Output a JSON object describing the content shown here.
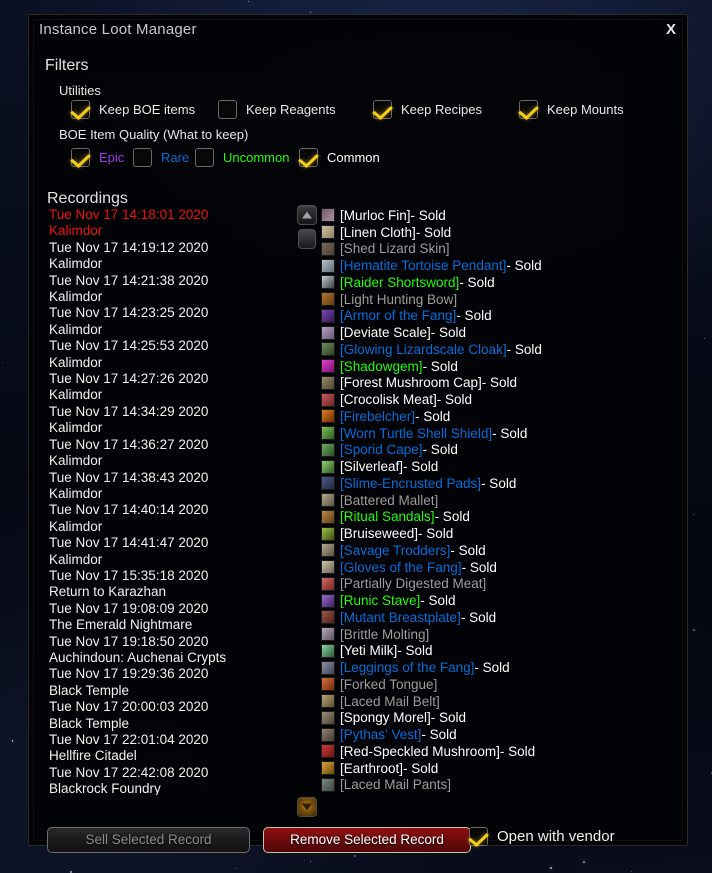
{
  "window": {
    "title": "Instance Loot Manager",
    "close_label": "X"
  },
  "filters": {
    "heading": "Filters",
    "utilities": {
      "heading": "Utilities",
      "options": [
        {
          "label": "Keep BOE items",
          "checked": true
        },
        {
          "label": "Keep Reagents",
          "checked": false
        },
        {
          "label": "Keep Recipes",
          "checked": true
        },
        {
          "label": "Keep Mounts",
          "checked": true
        }
      ]
    },
    "quality": {
      "heading": "BOE Item Quality (What to keep)",
      "options": [
        {
          "label": "Epic",
          "checked": true,
          "color": "#a335ee"
        },
        {
          "label": "Rare",
          "checked": false,
          "color": "#0070dd"
        },
        {
          "label": "Uncommon",
          "checked": false,
          "color": "#1eff00"
        },
        {
          "label": "Common",
          "checked": true,
          "color": "#ffffff"
        }
      ]
    }
  },
  "recordings": {
    "heading": "Recordings",
    "selected_index": 0,
    "items": [
      {
        "date": "Tue Nov 17 14:18:01 2020",
        "zone": "Kalimdor"
      },
      {
        "date": "Tue Nov 17 14:19:12 2020",
        "zone": "Kalimdor"
      },
      {
        "date": "Tue Nov 17 14:21:38 2020",
        "zone": "Kalimdor"
      },
      {
        "date": "Tue Nov 17 14:23:25 2020",
        "zone": "Kalimdor"
      },
      {
        "date": "Tue Nov 17 14:25:53 2020",
        "zone": "Kalimdor"
      },
      {
        "date": "Tue Nov 17 14:27:26 2020",
        "zone": "Kalimdor"
      },
      {
        "date": "Tue Nov 17 14:34:29 2020",
        "zone": "Kalimdor"
      },
      {
        "date": "Tue Nov 17 14:36:27 2020",
        "zone": "Kalimdor"
      },
      {
        "date": "Tue Nov 17 14:38:43 2020",
        "zone": "Kalimdor"
      },
      {
        "date": "Tue Nov 17 14:40:14 2020",
        "zone": "Kalimdor"
      },
      {
        "date": "Tue Nov 17 14:41:47 2020",
        "zone": "Kalimdor"
      },
      {
        "date": "Tue Nov 17 15:35:18 2020",
        "zone": "Return to Karazhan"
      },
      {
        "date": "Tue Nov 17 19:08:09 2020",
        "zone": "The Emerald Nightmare"
      },
      {
        "date": "Tue Nov 17 19:18:50 2020",
        "zone": "Auchindoun: Auchenai Crypts"
      },
      {
        "date": "Tue Nov 17 19:29:36 2020",
        "zone": "Black Temple"
      },
      {
        "date": "Tue Nov 17 20:00:03 2020",
        "zone": "Black Temple"
      },
      {
        "date": "Tue Nov 17 22:01:04 2020",
        "zone": "Hellfire Citadel"
      },
      {
        "date": "Tue Nov 17 22:42:08 2020",
        "zone": "Blackrock Foundry"
      }
    ]
  },
  "loot": {
    "status_sold": " - Sold",
    "quality_colors": {
      "poor": "#9d9d9d",
      "common": "#ffffff",
      "uncommon": "#1eff00",
      "rare": "#0070dd",
      "epic": "#a335ee"
    },
    "items": [
      {
        "name": "[Murloc Fin]",
        "quality": "common",
        "sold": true,
        "icon": "#6f5a68,#ad93a8"
      },
      {
        "name": "[Linen Cloth]",
        "quality": "common",
        "sold": true,
        "icon": "#cbbfa2,#8d8165"
      },
      {
        "name": "[Shed Lizard Skin]",
        "quality": "poor",
        "sold": false,
        "icon": "#7a6a5a,#4b4038"
      },
      {
        "name": "[Hematite Tortoise Pendant]",
        "quality": "rare",
        "sold": true,
        "icon": "#b9c3cc,#5f6a74"
      },
      {
        "name": "[Raider Shortsword]",
        "quality": "uncommon",
        "sold": true,
        "icon": "#c8cdd4,#3a3f46"
      },
      {
        "name": "[Light Hunting Bow]",
        "quality": "poor",
        "sold": false,
        "icon": "#b5762d,#5e3a12"
      },
      {
        "name": "[Armor of the Fang]",
        "quality": "rare",
        "sold": true,
        "icon": "#7b4bb5,#30184f"
      },
      {
        "name": "[Deviate Scale]",
        "quality": "common",
        "sold": true,
        "icon": "#b59ec0,#6b5a78"
      },
      {
        "name": "[Glowing Lizardscale Cloak]",
        "quality": "rare",
        "sold": true,
        "icon": "#6f8f5a,#2f4024"
      },
      {
        "name": "[Shadowgem]",
        "quality": "uncommon",
        "sold": true,
        "icon": "#e03fd0,#7a1370"
      },
      {
        "name": "[Forest Mushroom Cap]",
        "quality": "common",
        "sold": true,
        "icon": "#9a8a6d,#4f452f"
      },
      {
        "name": "[Crocolisk Meat]",
        "quality": "common",
        "sold": true,
        "icon": "#c85d5d,#6e2424"
      },
      {
        "name": "[Firebelcher]",
        "quality": "rare",
        "sold": true,
        "icon": "#e07a22,#6b2f06"
      },
      {
        "name": "[Worn Turtle Shell Shield]",
        "quality": "rare",
        "sold": true,
        "icon": "#7cc05a,#2f5a20"
      },
      {
        "name": "[Sporid Cape]",
        "quality": "rare",
        "sold": true,
        "icon": "#6fae64,#2b4a26"
      },
      {
        "name": "[Silverleaf]",
        "quality": "common",
        "sold": true,
        "icon": "#8fd06a,#2f5a24"
      },
      {
        "name": "[Slime-Encrusted Pads]",
        "quality": "rare",
        "sold": true,
        "icon": "#4d5a8a,#20263f"
      },
      {
        "name": "[Battered Mallet]",
        "quality": "poor",
        "sold": false,
        "icon": "#b5a78c,#5d5241"
      },
      {
        "name": "[Ritual Sandals]",
        "quality": "uncommon",
        "sold": true,
        "icon": "#c08a4a,#5c3c18"
      },
      {
        "name": "[Bruiseweed]",
        "quality": "common",
        "sold": true,
        "icon": "#9fbf4a,#3f5012"
      },
      {
        "name": "[Savage Trodders]",
        "quality": "rare",
        "sold": true,
        "icon": "#b3a88f,#58503f"
      },
      {
        "name": "[Gloves of the Fang]",
        "quality": "rare",
        "sold": true,
        "icon": "#cfc6ae,#6a6050"
      },
      {
        "name": "[Partially Digested Meat]",
        "quality": "poor",
        "sold": false,
        "icon": "#d06a6a,#742424"
      },
      {
        "name": "[Runic Stave]",
        "quality": "uncommon",
        "sold": true,
        "icon": "#9b6ad0,#3c2060"
      },
      {
        "name": "[Mutant Breastplate]",
        "quality": "rare",
        "sold": true,
        "icon": "#a2564a,#4a2018"
      },
      {
        "name": "[Brittle Molting]",
        "quality": "poor",
        "sold": false,
        "icon": "#b6a8bb,#5d5260"
      },
      {
        "name": "[Yeti Milk]",
        "quality": "common",
        "sold": true,
        "icon": "#8fd2a0,#2c5a3a"
      },
      {
        "name": "[Leggings of the Fang]",
        "quality": "rare",
        "sold": true,
        "icon": "#8a93a8,#3a4152"
      },
      {
        "name": "[Forked Tongue]",
        "quality": "poor",
        "sold": false,
        "icon": "#d4703c,#6e2d0c"
      },
      {
        "name": "[Laced Mail Belt]",
        "quality": "poor",
        "sold": false,
        "icon": "#b9a478,#5c4d2d"
      },
      {
        "name": "[Spongy Morel]",
        "quality": "common",
        "sold": true,
        "icon": "#9a8f7a,#4a4136"
      },
      {
        "name": "[Pythas' Vest]",
        "quality": "rare",
        "sold": true,
        "icon": "#8d8270,#433c30"
      },
      {
        "name": "[Red-Speckled Mushroom]",
        "quality": "common",
        "sold": true,
        "icon": "#d03a3a,#6c1414"
      },
      {
        "name": "[Earthroot]",
        "quality": "common",
        "sold": true,
        "icon": "#d8a23c,#6b4a0e"
      },
      {
        "name": "[Laced Mail Pants]",
        "quality": "poor",
        "sold": false,
        "icon": "#7d8a86,#394340"
      }
    ]
  },
  "actions": {
    "sell_label": "Sell Selected Record",
    "remove_label": "Remove Selected Record",
    "vendor_label": "Open with vendor",
    "vendor_checked": true
  }
}
